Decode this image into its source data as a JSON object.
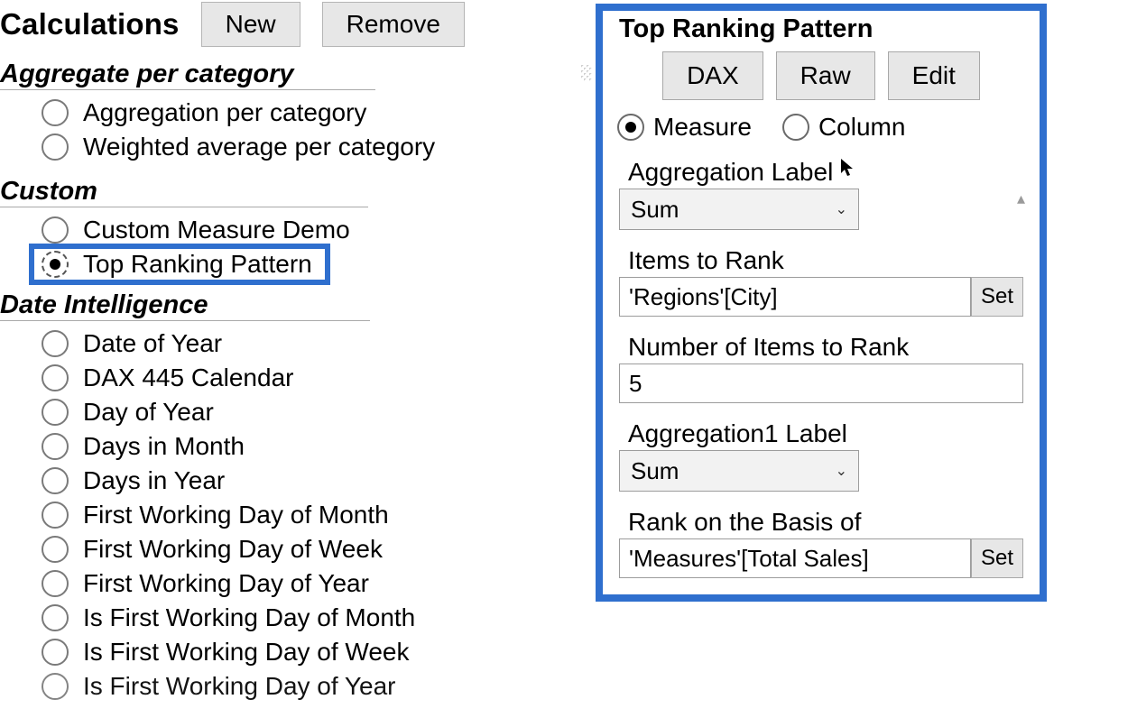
{
  "header": {
    "title": "Calculations",
    "new_label": "New",
    "remove_label": "Remove"
  },
  "groups": {
    "aggregate": {
      "label": "Aggregate per category",
      "items": [
        {
          "label": "Aggregation per category"
        },
        {
          "label": "Weighted average per category"
        }
      ]
    },
    "custom": {
      "label": "Custom",
      "items": [
        {
          "label": "Custom Measure Demo"
        },
        {
          "label": "Top Ranking Pattern",
          "selected": true
        }
      ]
    },
    "date": {
      "label": "Date Intelligence",
      "items": [
        {
          "label": "Date of Year"
        },
        {
          "label": "DAX 445 Calendar"
        },
        {
          "label": "Day of Year"
        },
        {
          "label": "Days in Month"
        },
        {
          "label": "Days in Year"
        },
        {
          "label": "First Working Day of Month"
        },
        {
          "label": "First Working Day of Week"
        },
        {
          "label": "First Working Day of Year"
        },
        {
          "label": "Is First Working Day of Month"
        },
        {
          "label": "Is First Working Day of Week"
        },
        {
          "label": "Is First Working Day of Year"
        }
      ]
    }
  },
  "detail": {
    "title": "Top Ranking Pattern",
    "buttons": {
      "dax": "DAX",
      "raw": "Raw",
      "edit": "Edit"
    },
    "mode": {
      "measure": "Measure",
      "column": "Column",
      "selected": "measure"
    },
    "fields": {
      "agg": {
        "label": "Aggregation Label",
        "value": "Sum"
      },
      "items_to_rank": {
        "label": "Items to Rank",
        "value": "'Regions'[City]",
        "set": "Set"
      },
      "n_items": {
        "label": "Number of Items to Rank",
        "value": "5"
      },
      "agg1": {
        "label": "Aggregation1 Label",
        "value": "Sum"
      },
      "rank_basis": {
        "label": "Rank on the Basis of",
        "value": "'Measures'[Total Sales]",
        "set": "Set"
      }
    }
  }
}
